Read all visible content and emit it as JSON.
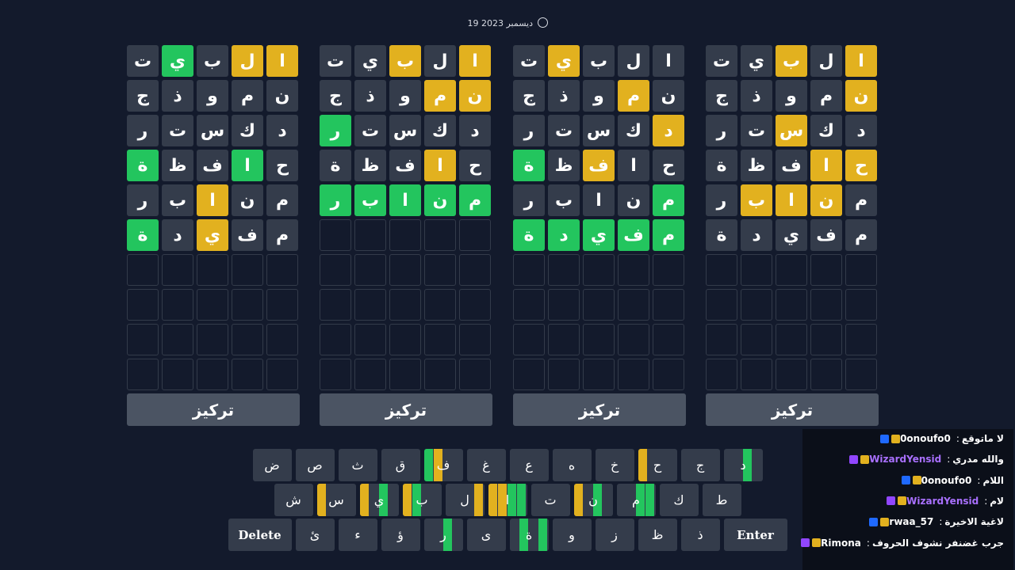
{
  "date": "19 ديسمبر 2023",
  "focus_label": "تركيز",
  "boards": [
    {
      "rows": [
        [
          [
            "ا",
            "y"
          ],
          [
            "ل",
            "y"
          ],
          [
            "ب",
            "n"
          ],
          [
            "ي",
            "g"
          ],
          [
            "ت",
            "n"
          ]
        ],
        [
          [
            "ن",
            "n"
          ],
          [
            "م",
            "n"
          ],
          [
            "و",
            "n"
          ],
          [
            "ذ",
            "n"
          ],
          [
            "ج",
            "n"
          ]
        ],
        [
          [
            "د",
            "n"
          ],
          [
            "ك",
            "n"
          ],
          [
            "س",
            "n"
          ],
          [
            "ت",
            "n"
          ],
          [
            "ر",
            "n"
          ]
        ],
        [
          [
            "ح",
            "n"
          ],
          [
            "ا",
            "g"
          ],
          [
            "ف",
            "n"
          ],
          [
            "ظ",
            "n"
          ],
          [
            "ة",
            "g"
          ]
        ],
        [
          [
            "م",
            "n"
          ],
          [
            "ن",
            "n"
          ],
          [
            "ا",
            "y"
          ],
          [
            "ب",
            "n"
          ],
          [
            "ر",
            "n"
          ]
        ],
        [
          [
            "م",
            "n"
          ],
          [
            "ف",
            "n"
          ],
          [
            "ي",
            "y"
          ],
          [
            "د",
            "n"
          ],
          [
            "ة",
            "g"
          ]
        ]
      ]
    },
    {
      "rows": [
        [
          [
            "ا",
            "y"
          ],
          [
            "ل",
            "n"
          ],
          [
            "ب",
            "y"
          ],
          [
            "ي",
            "n"
          ],
          [
            "ت",
            "n"
          ]
        ],
        [
          [
            "ن",
            "y"
          ],
          [
            "م",
            "y"
          ],
          [
            "و",
            "n"
          ],
          [
            "ذ",
            "n"
          ],
          [
            "ج",
            "n"
          ]
        ],
        [
          [
            "د",
            "n"
          ],
          [
            "ك",
            "n"
          ],
          [
            "س",
            "n"
          ],
          [
            "ت",
            "n"
          ],
          [
            "ر",
            "g"
          ]
        ],
        [
          [
            "ح",
            "n"
          ],
          [
            "ا",
            "y"
          ],
          [
            "ف",
            "n"
          ],
          [
            "ظ",
            "n"
          ],
          [
            "ة",
            "n"
          ]
        ],
        [
          [
            "م",
            "g"
          ],
          [
            "ن",
            "g"
          ],
          [
            "ا",
            "g"
          ],
          [
            "ب",
            "g"
          ],
          [
            "ر",
            "g"
          ]
        ]
      ]
    },
    {
      "rows": [
        [
          [
            "ا",
            "n"
          ],
          [
            "ل",
            "n"
          ],
          [
            "ب",
            "n"
          ],
          [
            "ي",
            "y"
          ],
          [
            "ت",
            "n"
          ]
        ],
        [
          [
            "ن",
            "n"
          ],
          [
            "م",
            "y"
          ],
          [
            "و",
            "n"
          ],
          [
            "ذ",
            "n"
          ],
          [
            "ج",
            "n"
          ]
        ],
        [
          [
            "د",
            "y"
          ],
          [
            "ك",
            "n"
          ],
          [
            "س",
            "n"
          ],
          [
            "ت",
            "n"
          ],
          [
            "ر",
            "n"
          ]
        ],
        [
          [
            "ح",
            "n"
          ],
          [
            "ا",
            "n"
          ],
          [
            "ف",
            "y"
          ],
          [
            "ظ",
            "n"
          ],
          [
            "ة",
            "g"
          ]
        ],
        [
          [
            "م",
            "g"
          ],
          [
            "ن",
            "n"
          ],
          [
            "ا",
            "n"
          ],
          [
            "ب",
            "n"
          ],
          [
            "ر",
            "n"
          ]
        ],
        [
          [
            "م",
            "g"
          ],
          [
            "ف",
            "g"
          ],
          [
            "ي",
            "g"
          ],
          [
            "د",
            "g"
          ],
          [
            "ة",
            "g"
          ]
        ]
      ]
    },
    {
      "rows": [
        [
          [
            "ا",
            "y"
          ],
          [
            "ل",
            "n"
          ],
          [
            "ب",
            "y"
          ],
          [
            "ي",
            "n"
          ],
          [
            "ت",
            "n"
          ]
        ],
        [
          [
            "ن",
            "y"
          ],
          [
            "م",
            "n"
          ],
          [
            "و",
            "n"
          ],
          [
            "ذ",
            "n"
          ],
          [
            "ج",
            "n"
          ]
        ],
        [
          [
            "د",
            "n"
          ],
          [
            "ك",
            "n"
          ],
          [
            "س",
            "y"
          ],
          [
            "ت",
            "n"
          ],
          [
            "ر",
            "n"
          ]
        ],
        [
          [
            "ح",
            "y"
          ],
          [
            "ا",
            "y"
          ],
          [
            "ف",
            "n"
          ],
          [
            "ظ",
            "n"
          ],
          [
            "ة",
            "n"
          ]
        ],
        [
          [
            "م",
            "n"
          ],
          [
            "ن",
            "y"
          ],
          [
            "ا",
            "y"
          ],
          [
            "ب",
            "y"
          ],
          [
            "ر",
            "n"
          ]
        ],
        [
          [
            "م",
            "n"
          ],
          [
            "ف",
            "n"
          ],
          [
            "ي",
            "n"
          ],
          [
            "د",
            "n"
          ],
          [
            "ة",
            "n"
          ]
        ]
      ]
    }
  ],
  "keyboard": [
    [
      [
        "د",
        "n,g,n,n"
      ],
      [
        "ج",
        "n,n,n,n"
      ],
      [
        "ح",
        "n,n,n,y"
      ],
      [
        "خ",
        "n,n,n,n"
      ],
      [
        "ه",
        "n,n,n,n"
      ],
      [
        "ع",
        "n,n,n,n"
      ],
      [
        "غ",
        "n,n,n,n"
      ],
      [
        "ف",
        "n,n,y,g"
      ],
      [
        "ق",
        "n,n,n,n"
      ],
      [
        "ث",
        "n,n,n,n"
      ],
      [
        "ص",
        "n,n,n,n"
      ],
      [
        "ض",
        "n,n,n,n"
      ]
    ],
    [
      [
        "ط",
        "n,n,n,n"
      ],
      [
        "ك",
        "n,n,n,n"
      ],
      [
        "م",
        "g,g,n,n"
      ],
      [
        "ن",
        "n,g,n,y"
      ],
      [
        "ت",
        "n,n,n,n"
      ],
      [
        "ا",
        "g,g,y,y"
      ],
      [
        "ل",
        "y,n,n,n"
      ],
      [
        "ب",
        "n,n,g,y"
      ],
      [
        "ي",
        "n,g,n,y"
      ],
      [
        "س",
        "n,n,n,y"
      ],
      [
        "ش",
        "n,n,n,n"
      ]
    ],
    [
      [
        "Enter",
        "enter"
      ],
      [
        "ذ",
        "n,n,n,n"
      ],
      [
        "ظ",
        "n,n,n,n"
      ],
      [
        "ز",
        "n,n,n,n"
      ],
      [
        "و",
        "n,n,n,n"
      ],
      [
        "ة",
        "g,n,g,n"
      ],
      [
        "ى",
        "n,n,n,n"
      ],
      [
        "ر",
        "n,g,n,n"
      ],
      [
        "ؤ",
        "n,n,n,n"
      ],
      [
        "ء",
        "n,n,n,n"
      ],
      [
        "ئ",
        "n,n,n,n"
      ],
      [
        "Delete",
        "delete"
      ]
    ]
  ],
  "chat": [
    {
      "user": "0onoufo0",
      "text": "لا ماتوقع",
      "color": "#ffffff"
    },
    {
      "user": "WizardYensid",
      "text": "والله مدري",
      "color": "#a970ff"
    },
    {
      "user": "0onoufo0",
      "text": "اللام",
      "color": "#ffffff"
    },
    {
      "user": "WizardYensid",
      "text": "لام",
      "color": "#a970ff"
    },
    {
      "user": "rwaa_57",
      "text": "لاغية الاخيرة",
      "color": "#ffffff"
    },
    {
      "user": "Rimona",
      "text": "جرب غضنفر نشوف الحروف",
      "color": "#ffffff"
    }
  ]
}
